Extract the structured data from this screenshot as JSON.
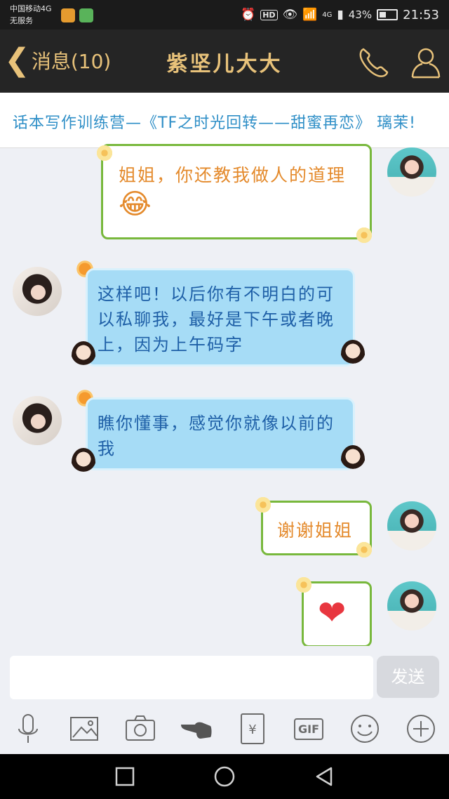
{
  "status_bar": {
    "carrier_line1": "中国移动4G",
    "carrier_line2": "无服务",
    "hd": "HD",
    "signal_label": "4G",
    "battery_percent": "43%",
    "time": "21:53"
  },
  "header": {
    "back_label": "消息(10)",
    "title": "紫坚儿大大"
  },
  "banner": {
    "text": "话本写作训练营—《TF之时光回转——甜蜜再恋》 璃茉!"
  },
  "messages": [
    {
      "from": "self",
      "text": "姐姐，你还教我做人的道理",
      "emoji": "😂"
    },
    {
      "from": "peer",
      "text": "这样吧！以后你有不明白的可以私聊我，最好是下午或者晚上，因为上午码字"
    },
    {
      "from": "peer",
      "text": "瞧你懂事，感觉你就像以前的我"
    },
    {
      "from": "self",
      "text": "谢谢姐姐"
    },
    {
      "from": "self",
      "emoji": "❤"
    }
  ],
  "input": {
    "placeholder": "",
    "send_label": "发送"
  },
  "toolbar": {
    "items": [
      "microphone-icon",
      "image-icon",
      "camera-icon",
      "poke-icon",
      "red-packet-icon",
      "gif-icon",
      "emoji-icon",
      "plus-icon"
    ],
    "gif_label": "GIF",
    "yen_label": "¥"
  },
  "colors": {
    "title_gold": "#e8c27a",
    "self_text": "#e48a2c",
    "self_border": "#78b83c",
    "peer_bubble": "#a6dcf6",
    "peer_text": "#1e5fa7",
    "banner_text": "#2f8fc7"
  }
}
